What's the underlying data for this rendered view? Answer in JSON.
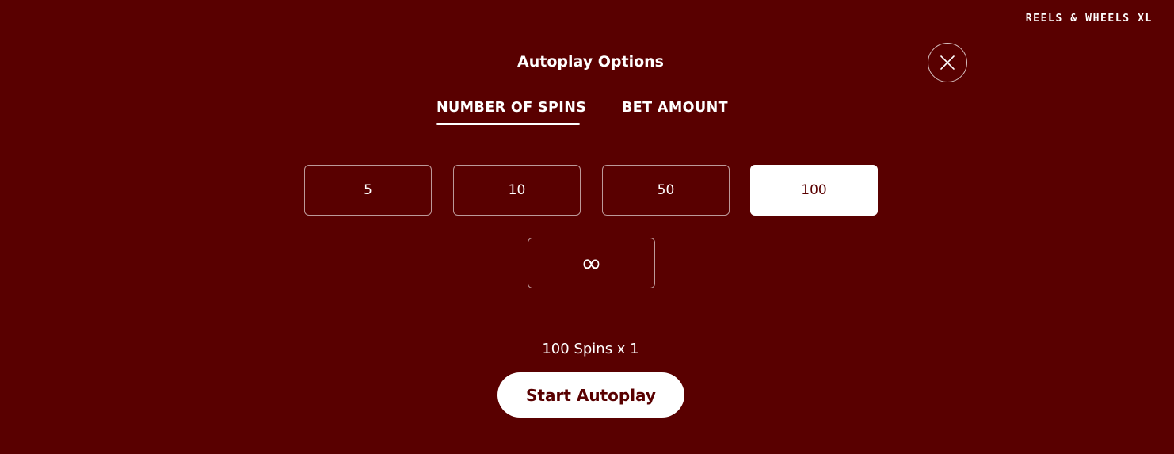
{
  "brand": "REELS & WHEELS XL",
  "dialog": {
    "title": "Autoplay Options",
    "close_icon": "close-icon"
  },
  "tabs": [
    {
      "label": "NUMBER OF SPINS",
      "active": true
    },
    {
      "label": "BET AMOUNT",
      "active": false
    }
  ],
  "spin_options": [
    {
      "label": "5",
      "selected": false
    },
    {
      "label": "10",
      "selected": false
    },
    {
      "label": "50",
      "selected": false
    },
    {
      "label": "100",
      "selected": true
    },
    {
      "label": "∞",
      "selected": false
    }
  ],
  "summary": "100 Spins x 1",
  "start_button": "Start Autoplay",
  "colors": {
    "background": "#590000",
    "foreground": "#ffffff"
  }
}
